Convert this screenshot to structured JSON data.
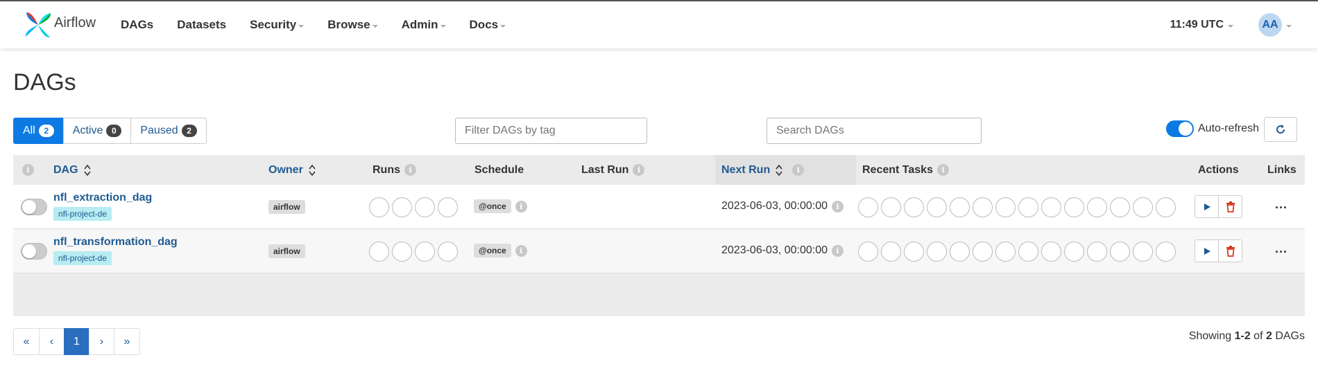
{
  "brand": {
    "name": "Airflow"
  },
  "nav": {
    "items": [
      {
        "label": "DAGs",
        "dropdown": false
      },
      {
        "label": "Datasets",
        "dropdown": false
      },
      {
        "label": "Security",
        "dropdown": true
      },
      {
        "label": "Browse",
        "dropdown": true
      },
      {
        "label": "Admin",
        "dropdown": true
      },
      {
        "label": "Docs",
        "dropdown": true
      }
    ],
    "clock": "11:49 UTC",
    "avatar": "AA"
  },
  "page": {
    "title": "DAGs"
  },
  "filters": {
    "all_label": "All",
    "all_count": "2",
    "active_label": "Active",
    "active_count": "0",
    "paused_label": "Paused",
    "paused_count": "2",
    "tag_placeholder": "Filter DAGs by tag",
    "search_placeholder": "Search DAGs",
    "autorefresh_label": "Auto-refresh",
    "autorefresh_on": true
  },
  "table": {
    "headers": {
      "dag": "DAG",
      "owner": "Owner",
      "runs": "Runs",
      "schedule": "Schedule",
      "last_run": "Last Run",
      "next_run": "Next Run",
      "recent_tasks": "Recent Tasks",
      "actions": "Actions",
      "links": "Links"
    },
    "rows": [
      {
        "dag_id": "nfl_extraction_dag",
        "tag": "nfl-project-de",
        "owner": "airflow",
        "schedule": "@once",
        "last_run": "",
        "next_run": "2023-06-03, 00:00:00",
        "paused": true,
        "links": "..."
      },
      {
        "dag_id": "nfl_transformation_dag",
        "tag": "nfl-project-de",
        "owner": "airflow",
        "schedule": "@once",
        "last_run": "",
        "next_run": "2023-06-03, 00:00:00",
        "paused": true,
        "links": "..."
      }
    ],
    "info_glyph": "i"
  },
  "pagination": {
    "first": "«",
    "prev": "‹",
    "current": "1",
    "next": "›",
    "last": "»"
  },
  "footer": {
    "showing_prefix": "Showing",
    "range": "1-2",
    "of": "of",
    "total": "2",
    "suffix": "DAGs"
  },
  "colors": {
    "accent": "#0d7ae3",
    "link": "#1f5a91",
    "tag_bg": "#b6ecf2",
    "delete": "#d9381e"
  }
}
